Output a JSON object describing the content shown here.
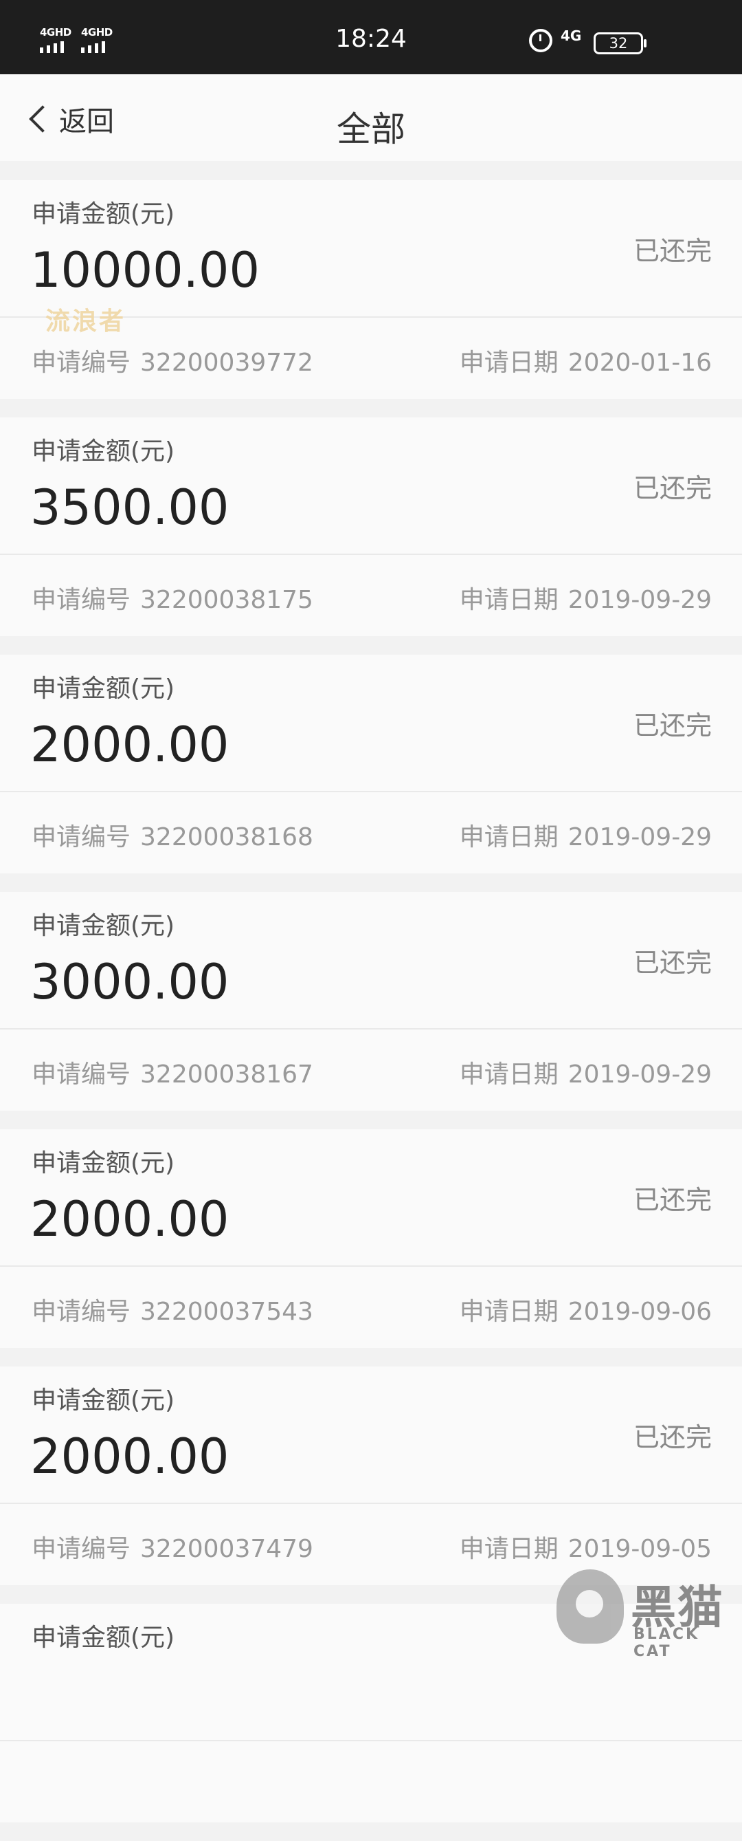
{
  "status_bar": {
    "sim1_network": "4GHD",
    "sim2_network": "4GHD",
    "time": "18:24",
    "data_network": "4G",
    "battery": "32",
    "sim1_signal_icon": "signal-bars-icon",
    "sim2_signal_icon": "signal-bars-icon",
    "alarm_icon": "alarm-clock-icon",
    "battery_icon": "battery-icon"
  },
  "nav": {
    "back_icon": "chevron-left-icon",
    "back_label": "返回",
    "title": "全部"
  },
  "watermark": "流浪者",
  "records": [
    {
      "amount_label": "申请金额(元)",
      "amount": "10000.00",
      "status": "已还完",
      "apply_no_label": "申请编号",
      "apply_no": "32200039772",
      "apply_date_label": "申请日期",
      "apply_date": "2020-01-16"
    },
    {
      "amount_label": "申请金额(元)",
      "amount": "3500.00",
      "status": "已还完",
      "apply_no_label": "申请编号",
      "apply_no": "32200038175",
      "apply_date_label": "申请日期",
      "apply_date": "2019-09-29"
    },
    {
      "amount_label": "申请金额(元)",
      "amount": "2000.00",
      "status": "已还完",
      "apply_no_label": "申请编号",
      "apply_no": "32200038168",
      "apply_date_label": "申请日期",
      "apply_date": "2019-09-29"
    },
    {
      "amount_label": "申请金额(元)",
      "amount": "3000.00",
      "status": "已还完",
      "apply_no_label": "申请编号",
      "apply_no": "32200038167",
      "apply_date_label": "申请日期",
      "apply_date": "2019-09-29"
    },
    {
      "amount_label": "申请金额(元)",
      "amount": "2000.00",
      "status": "已还完",
      "apply_no_label": "申请编号",
      "apply_no": "32200037543",
      "apply_date_label": "申请日期",
      "apply_date": "2019-09-06"
    },
    {
      "amount_label": "申请金额(元)",
      "amount": "2000.00",
      "status": "已还完",
      "apply_no_label": "申请编号",
      "apply_no": "32200037479",
      "apply_date_label": "申请日期",
      "apply_date": "2019-09-05"
    },
    {
      "amount_label": "申请金额(元)",
      "amount": "",
      "status": "",
      "apply_no_label": "",
      "apply_no": "",
      "apply_date_label": "",
      "apply_date": ""
    }
  ],
  "logo": {
    "icon": "black-cat-logo-icon",
    "cn": "黑猫",
    "en": "BLACK CAT"
  }
}
